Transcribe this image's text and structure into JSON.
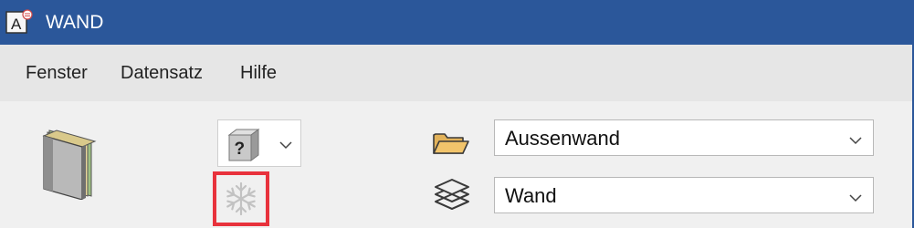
{
  "window": {
    "title": "WAND"
  },
  "menu": {
    "items": [
      "Fenster",
      "Datensatz",
      "Hilfe"
    ]
  },
  "toolbar": {
    "type_dropdown_icon": "question-mark-block-icon",
    "freeze_icon": "snowflake-icon",
    "book_icon": "book-stack-icon"
  },
  "fields": {
    "catalog": {
      "icon": "folder-icon",
      "value": "Aussenwand"
    },
    "layer": {
      "icon": "layers-icon",
      "value": "Wand"
    }
  },
  "colors": {
    "titlebar": "#2b579a",
    "highlight_border": "#e8323c",
    "folder": "#f2c46b"
  }
}
